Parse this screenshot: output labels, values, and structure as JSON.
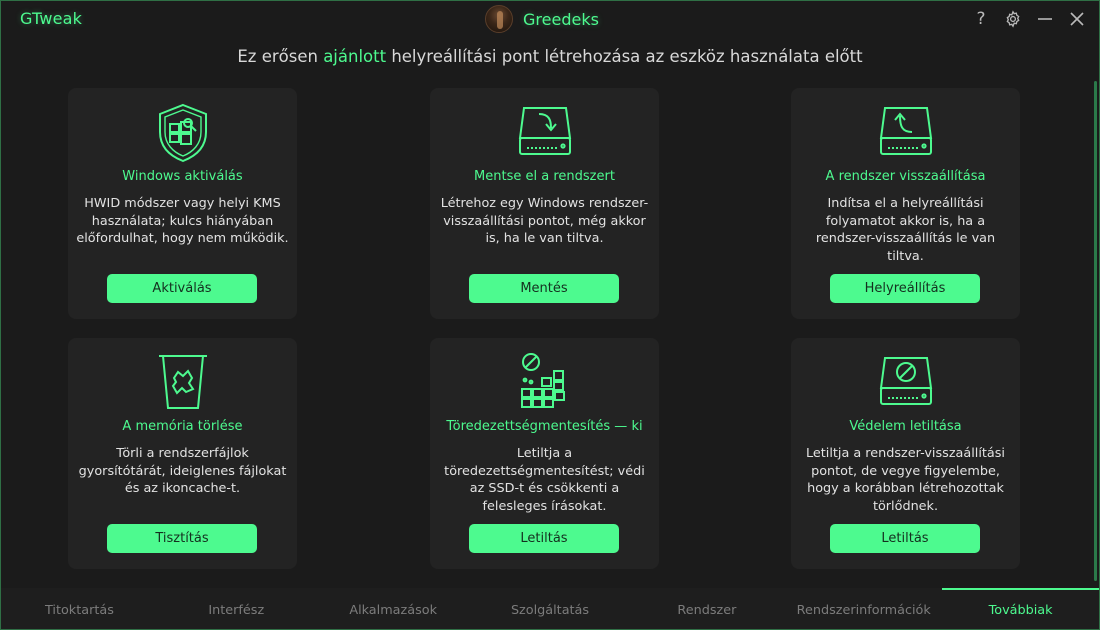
{
  "app": {
    "title": "GTweak",
    "brand_name": "Greedeks"
  },
  "titlebar": {
    "help_symbol": "?",
    "settings_icon": "gear-icon",
    "minimize_icon": "minimize-icon",
    "close_icon": "close-icon"
  },
  "header": {
    "prefix": "Ez erősen ",
    "highlight": "ajánlott",
    "suffix": " helyreállítási pont létrehozása az eszköz használata előtt"
  },
  "cards": [
    {
      "icon": "windows-shield-icon",
      "title": "Windows aktiválás",
      "description": "HWID módszer vagy helyi KMS használata; kulcs hiányában előfordulhat, hogy nem működik.",
      "button": "Aktiválás"
    },
    {
      "icon": "drive-save-icon",
      "title": "Mentse el a rendszert",
      "description": "Létrehoz egy Windows rendszer-visszaállítási pontot, még akkor is, ha le van tiltva.",
      "button": "Mentés"
    },
    {
      "icon": "drive-restore-icon",
      "title": "A rendszer visszaállítása",
      "description": "Indítsa el a helyreállítási folyamatot akkor is, ha a rendszer-visszaállítás le van tiltva.",
      "button": "Helyreállítás"
    },
    {
      "icon": "recycle-bin-icon",
      "title": "A memória törlése",
      "description": "Törli a rendszerfájlok gyorsítótárát, ideiglenes fájlokat és az ikoncache-t.",
      "button": "Tisztítás"
    },
    {
      "icon": "defrag-blocks-icon",
      "title": "Töredezettségmentesítés — ki",
      "description": "Letiltja a töredezettségmentesítést; védi az SSD-t és csökkenti a felesleges írásokat.",
      "button": "Letiltás"
    },
    {
      "icon": "drive-disabled-icon",
      "title": "Védelem letiltása",
      "description": "Letiltja a rendszer-visszaállítási pontot, de vegye figyelembe, hogy a korábban létrehozottak törlődnek.",
      "button": "Letiltás"
    }
  ],
  "tabs": [
    {
      "label": "Titoktartás",
      "active": false
    },
    {
      "label": "Interfész",
      "active": false
    },
    {
      "label": "Alkalmazások",
      "active": false
    },
    {
      "label": "Szolgáltatás",
      "active": false
    },
    {
      "label": "Rendszer",
      "active": false
    },
    {
      "label": "Rendszerinformációk",
      "active": false
    },
    {
      "label": "Továbbiak",
      "active": true
    }
  ],
  "colors": {
    "accent": "#4dfa8f",
    "background": "#1b1b1b",
    "card": "#232323",
    "muted_text": "#7c7c7c"
  }
}
